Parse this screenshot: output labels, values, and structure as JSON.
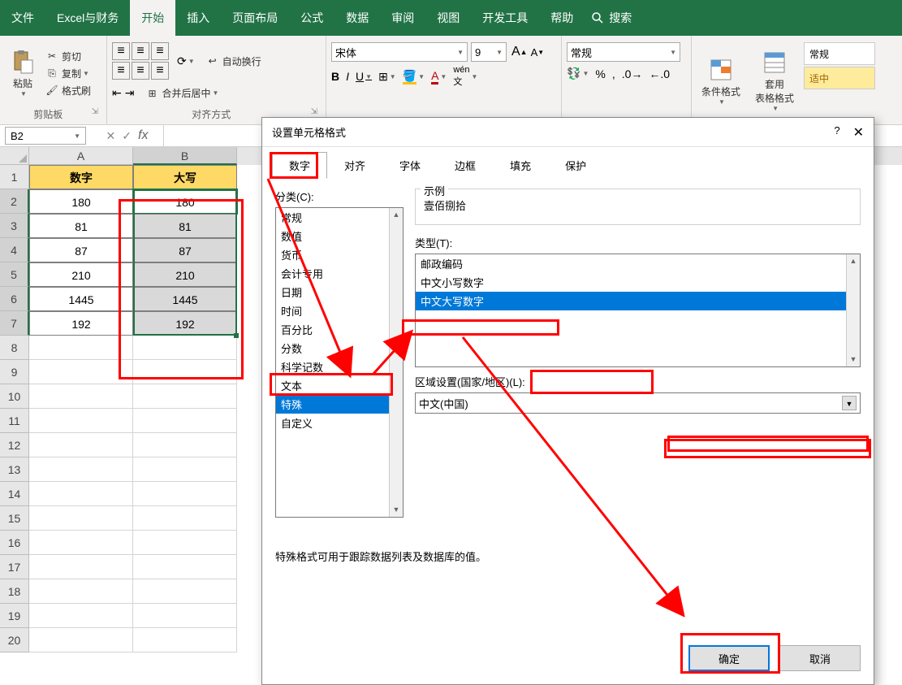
{
  "titlebar": {
    "tabs": [
      "文件",
      "Excel与财务",
      "开始",
      "插入",
      "页面布局",
      "公式",
      "数据",
      "审阅",
      "视图",
      "开发工具",
      "帮助"
    ],
    "active_tab": 2,
    "search_label": "搜索"
  },
  "ribbon": {
    "clipboard": {
      "paste_label": "粘贴",
      "cut_label": "剪切",
      "copy_label": "复制",
      "format_painter_label": "格式刷",
      "group_label": "剪贴板"
    },
    "alignment": {
      "wrap_label": "自动换行",
      "merge_label": "合并后居中",
      "group_label": "对齐方式"
    },
    "font": {
      "font_name": "宋体",
      "font_size": "9",
      "number_format": "常规"
    },
    "styles": {
      "conditional_label": "条件格式",
      "table_format_label": "套用\n表格格式",
      "cell_style1": "常规",
      "cell_style2": "适中"
    }
  },
  "formula_bar": {
    "name_box": "B2"
  },
  "grid": {
    "columns": [
      "A",
      "B"
    ],
    "selected_col": 1,
    "headers": {
      "A": "数字",
      "B": "大写"
    },
    "rows": [
      {
        "n": 1,
        "A": "数字",
        "B": "大写",
        "hdr": true
      },
      {
        "n": 2,
        "A": "180",
        "B": "180"
      },
      {
        "n": 3,
        "A": "81",
        "B": "81"
      },
      {
        "n": 4,
        "A": "87",
        "B": "87"
      },
      {
        "n": 5,
        "A": "210",
        "B": "210"
      },
      {
        "n": 6,
        "A": "1445",
        "B": "1445"
      },
      {
        "n": 7,
        "A": "192",
        "B": "192"
      }
    ],
    "empty_rows": [
      8,
      9,
      10,
      11,
      12,
      13,
      14,
      15,
      16,
      17,
      18,
      19,
      20
    ]
  },
  "dialog": {
    "title": "设置单元格格式",
    "tabs": [
      "数字",
      "对齐",
      "字体",
      "边框",
      "填充",
      "保护"
    ],
    "active_tab": 0,
    "category_label": "分类(C):",
    "categories": [
      "常规",
      "数值",
      "货币",
      "会计专用",
      "日期",
      "时间",
      "百分比",
      "分数",
      "科学记数",
      "文本",
      "特殊",
      "自定义"
    ],
    "selected_category": 10,
    "sample_label": "示例",
    "sample_value": "壹佰捌拾",
    "type_label": "类型(T):",
    "types": [
      "邮政编码",
      "中文小写数字",
      "中文大写数字"
    ],
    "selected_type": 2,
    "locale_label": "区域设置(国家/地区)(L):",
    "locale_value": "中文(中国)",
    "hint": "特殊格式可用于跟踪数据列表及数据库的值。",
    "ok_label": "确定",
    "cancel_label": "取消"
  }
}
